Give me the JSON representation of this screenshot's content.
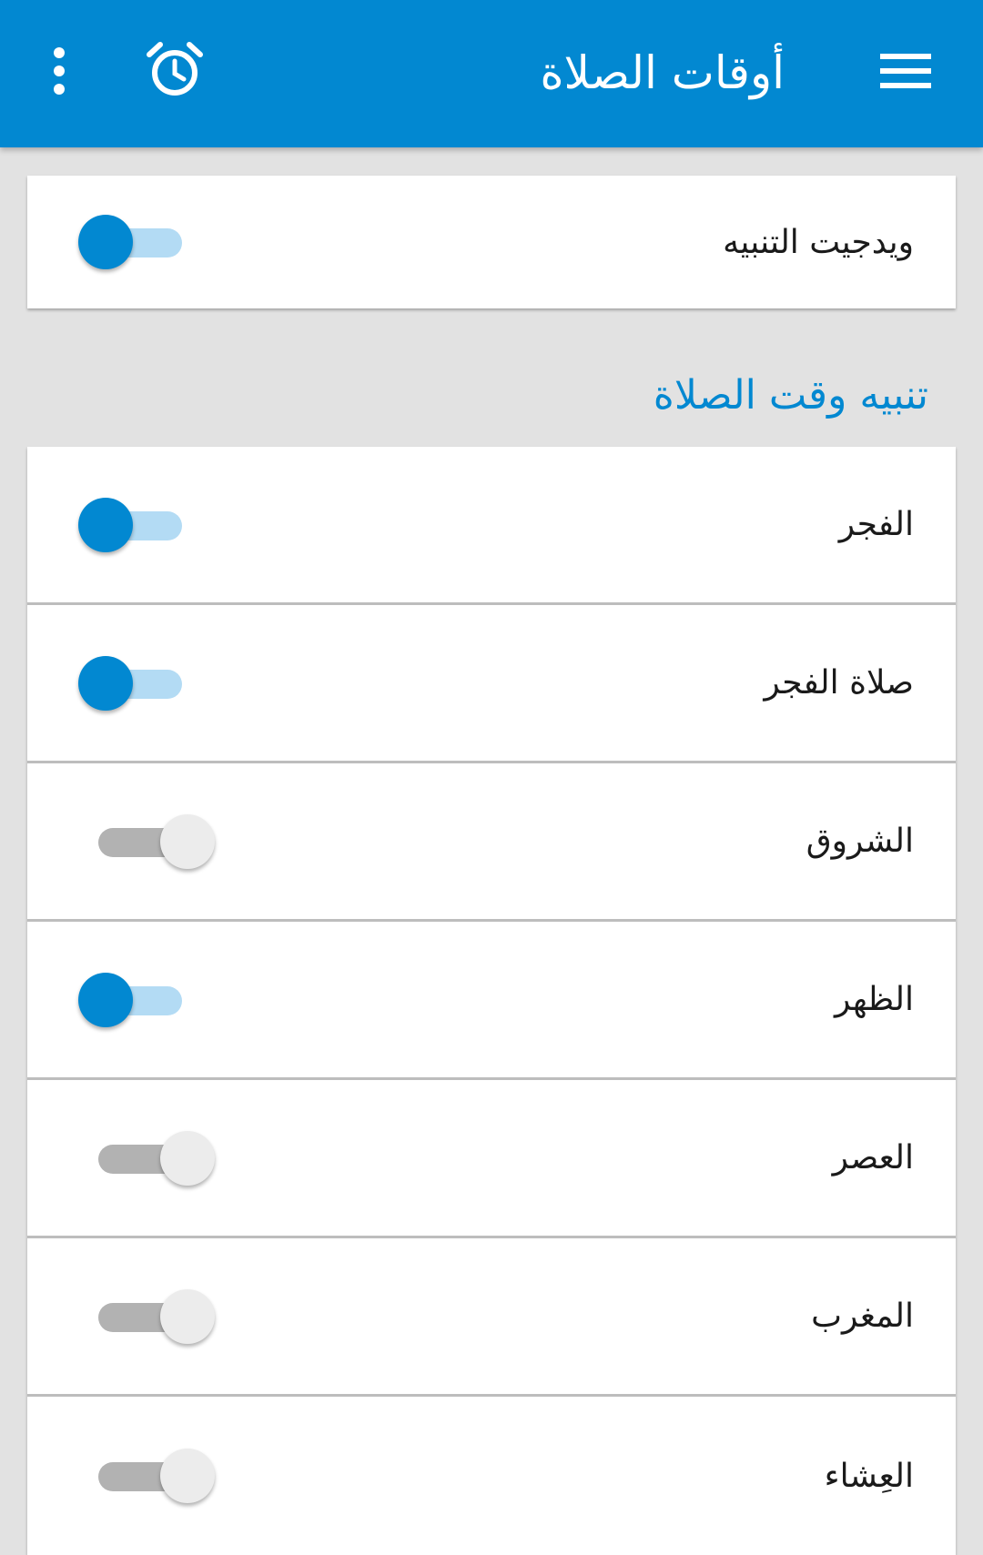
{
  "app_bar": {
    "title": "أوقات الصلاة",
    "menu_icon": "hamburger-menu-icon",
    "alarm_icon": "alarm-clock-icon",
    "more_icon": "more-vert-icon",
    "color": "#0288d1"
  },
  "widget_setting": {
    "label": "ويدجيت التنبيه",
    "enabled": true
  },
  "section": {
    "title": "تنبيه وقت الصلاة"
  },
  "prayers": [
    {
      "label": "الفجر",
      "enabled": true
    },
    {
      "label": "صلاة الفجر",
      "enabled": true
    },
    {
      "label": "الشروق",
      "enabled": false
    },
    {
      "label": "الظهر",
      "enabled": true
    },
    {
      "label": "العصر",
      "enabled": false
    },
    {
      "label": "المغرب",
      "enabled": false
    },
    {
      "label": "العِشاء",
      "enabled": false
    }
  ],
  "colors": {
    "accent": "#0288d1",
    "switch_track_on": "#b3dbf4",
    "switch_track_off": "#b2b2b2",
    "background": "#e2e2e2"
  }
}
